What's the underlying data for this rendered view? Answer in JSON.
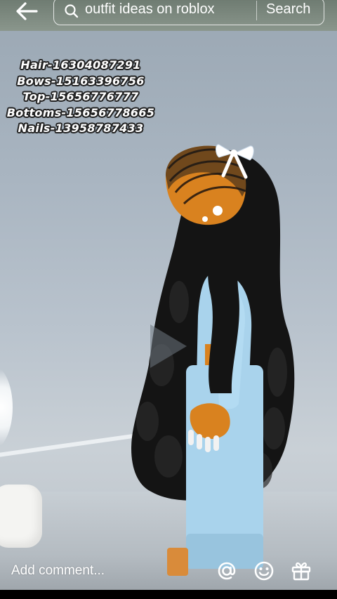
{
  "search": {
    "query": "outfit ideas on roblox",
    "button_label": "Search"
  },
  "outfit_codes": [
    "Hair-16304087291",
    "Bows-15163396756",
    "Top-15656776777",
    "Bottoms-15656778665",
    "Nails-13958787433"
  ],
  "comment": {
    "placeholder": "Add comment..."
  },
  "icons": {
    "back": "arrow-left-icon",
    "search": "search-icon",
    "play": "play-icon",
    "mention": "at-sign-icon",
    "emoji": "emoji-icon",
    "gift": "gift-icon"
  },
  "colors": {
    "top_bar": "#7b877e",
    "outfit_blue": "#a9d3ec",
    "skin": "#d9821f",
    "hair": "#141414"
  }
}
